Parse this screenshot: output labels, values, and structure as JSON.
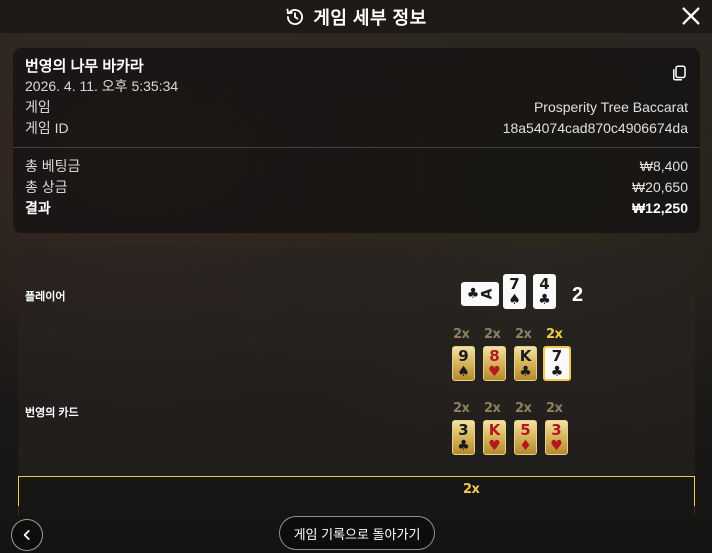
{
  "header": {
    "title": "게임 세부 정보"
  },
  "summary": {
    "game_name": "번영의 나무 바카라",
    "datetime": "2026. 4. 11. 오후 5:35:34",
    "game_label": "게임",
    "game_value": "Prosperity Tree Baccarat",
    "game_id_label": "게임 ID",
    "game_id_value": "18a54074cad870c4906674da",
    "total_bet_label": "총 베팅금",
    "total_bet_value": "₩8,400",
    "total_win_label": "총 상금",
    "total_win_value": "₩20,650",
    "result_label": "결과",
    "result_value": "₩12,250"
  },
  "result": {
    "player_label": "플레이어",
    "player_score": "2",
    "player_cards": [
      {
        "rank": "A",
        "suit": "♣",
        "color": "blk"
      },
      {
        "rank": "7",
        "suit": "♠",
        "color": "blk"
      },
      {
        "rank": "4",
        "suit": "♣",
        "color": "blk"
      }
    ],
    "multiplier": "2x",
    "tree_row": [
      {
        "rank": "9",
        "suit": "♠",
        "color": "blk"
      },
      {
        "rank": "8",
        "suit": "♥",
        "color": "red"
      },
      {
        "rank": "K",
        "suit": "♣",
        "color": "blk"
      },
      {
        "rank": "7",
        "suit": "♣",
        "color": "blk"
      }
    ],
    "prosperity_label": "번영의 카드",
    "prosperity_row": [
      {
        "rank": "3",
        "suit": "♣",
        "color": "blk"
      },
      {
        "rank": "K",
        "suit": "♥",
        "color": "red"
      },
      {
        "rank": "5",
        "suit": "♦",
        "color": "red"
      },
      {
        "rank": "3",
        "suit": "♥",
        "color": "red"
      }
    ]
  },
  "footer": {
    "history_button": "게임 기록으로 돌아가기"
  },
  "icons": {
    "history": "history-icon",
    "close": "close-icon",
    "copy": "copy-icon",
    "back": "chevron-left-icon"
  },
  "colors": {
    "accent_gold": "#f2c94c"
  }
}
